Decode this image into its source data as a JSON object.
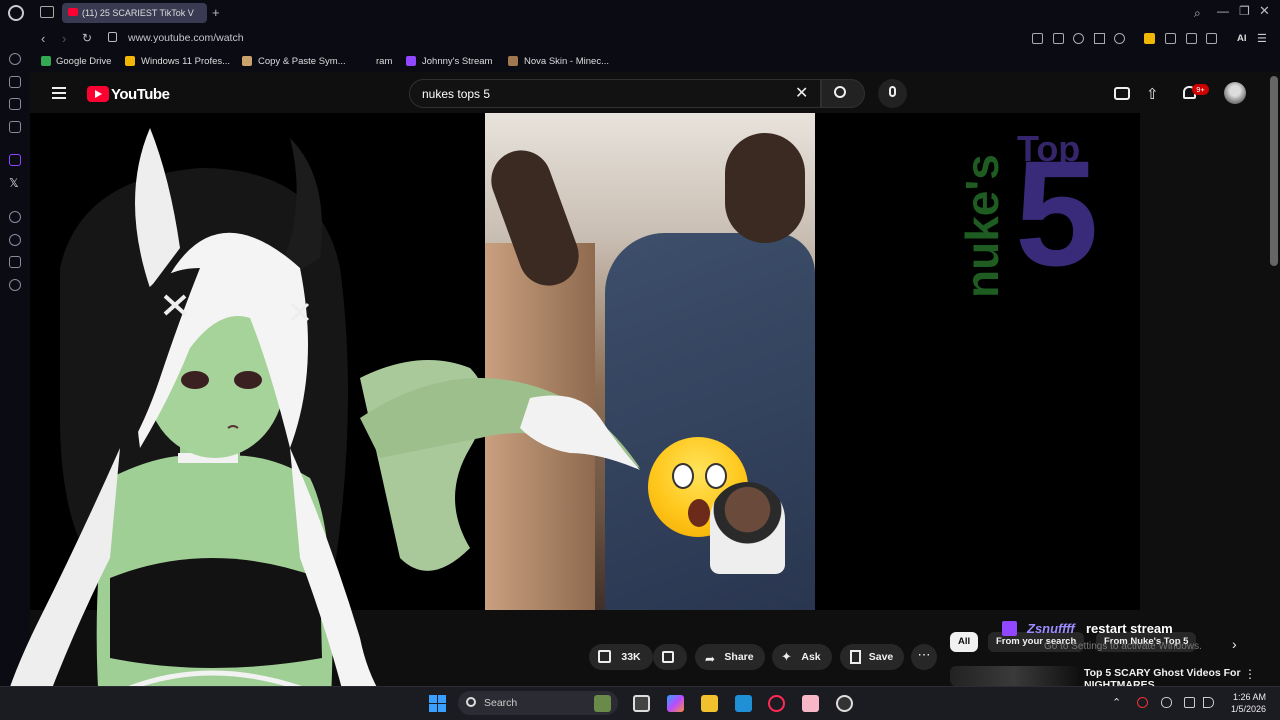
{
  "browser": {
    "tab_title": "(11) 25 SCARIEST TikTok V",
    "url": "www.youtube.com/watch",
    "ai_label": "AI",
    "bookmarks": [
      {
        "label": "Google Drive",
        "icon": "google-drive-icon",
        "color": "#34a853"
      },
      {
        "label": "Windows 11 Profes...",
        "icon": "crown-icon",
        "color": "#f2b705"
      },
      {
        "label": "Copy & Paste Sym...",
        "icon": "pencil-icon",
        "color": "#c9a36b"
      },
      {
        "label": "ram",
        "icon": "",
        "color": ""
      },
      {
        "label": "Johnny's Stream",
        "icon": "twitch-icon",
        "color": "#9146ff"
      },
      {
        "label": "Nova Skin - Minec...",
        "icon": "cube-icon",
        "color": "#a07850"
      }
    ]
  },
  "youtube": {
    "logo_text": "YouTube",
    "search_query": "nukes tops 5",
    "notification_badge": "9+",
    "actions": {
      "likes": "33K",
      "share": "Share",
      "ask": "Ask",
      "save": "Save",
      "more": "⋯"
    },
    "chips": [
      "All",
      "From your search",
      "From Nuke's Top 5"
    ],
    "recommendation": {
      "title": "Top 5 SCARY Ghost Videos For NIGHTMARES"
    },
    "channel_art": {
      "word": "nuke's",
      "top": "Top",
      "five": "5"
    }
  },
  "stream_overlay": {
    "username": "Zsnuffff",
    "status": "restart stream"
  },
  "windows_watermark": "Go to Settings to activate Windows.",
  "taskbar": {
    "search_placeholder": "Search",
    "time": "1:26 AM",
    "date": "1/5/2026"
  },
  "colors": {
    "youtube_red": "#ff0033",
    "twitch_purple": "#9146ff",
    "background": "#0f0f0f"
  }
}
